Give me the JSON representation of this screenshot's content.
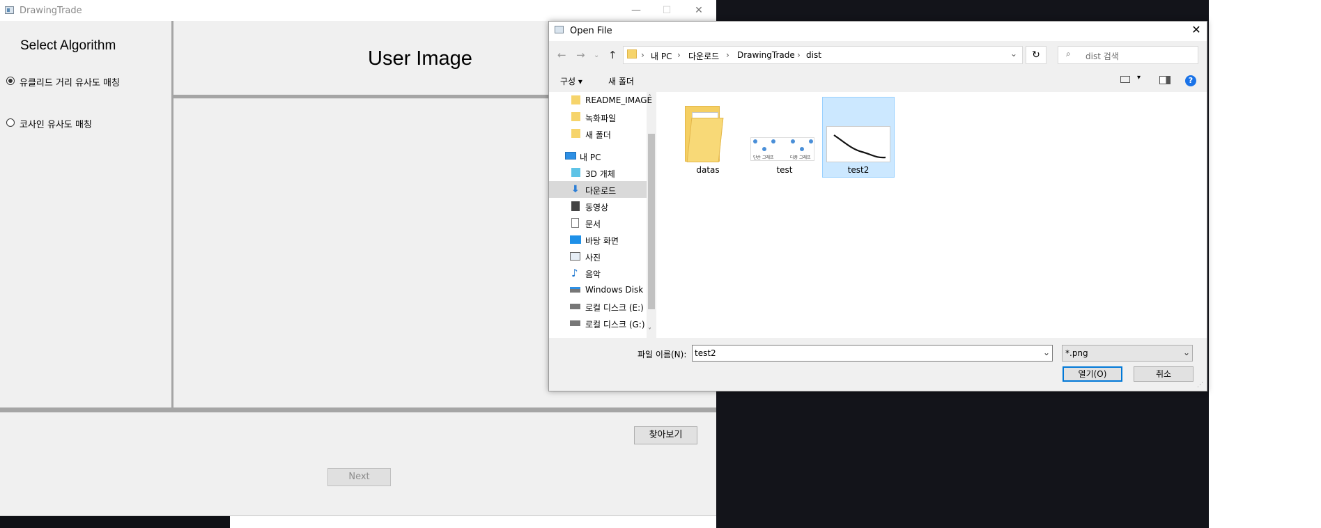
{
  "app": {
    "title": "DrawingTrade",
    "select_title": "Select Algorithm",
    "radio_1": "유클리드 거리 유사도 매칭",
    "radio_2": "코사인 유사도 매칭",
    "user_title": "User Image",
    "browse_button": "찾아보기",
    "next_button": "Next"
  },
  "dialog": {
    "title": "Open File",
    "breadcrumbs": [
      "내 PC",
      "다운로드",
      "DrawingTrade",
      "dist"
    ],
    "search_placeholder": "dist 검색",
    "toolbar": {
      "organize": "구성 ▾",
      "new_folder": "새 폴더"
    },
    "nav_items": [
      {
        "label": "README_IMAGE",
        "icon": "folder-icon"
      },
      {
        "label": "녹화파일",
        "icon": "folder-icon"
      },
      {
        "label": "새 폴더",
        "icon": "folder-icon"
      },
      {
        "label": "내 PC",
        "icon": "computer-icon"
      },
      {
        "label": "3D 개체",
        "icon": "3d-objects-icon"
      },
      {
        "label": "다운로드",
        "icon": "download-icon"
      },
      {
        "label": "동영상",
        "icon": "video-icon"
      },
      {
        "label": "문서",
        "icon": "document-icon"
      },
      {
        "label": "바탕 화면",
        "icon": "desktop-icon"
      },
      {
        "label": "사진",
        "icon": "pictures-icon"
      },
      {
        "label": "음악",
        "icon": "music-icon"
      },
      {
        "label": "Windows Disk (",
        "icon": "drive-icon"
      },
      {
        "label": "로컬 디스크 (E:)",
        "icon": "drive-icon"
      },
      {
        "label": "로컬 디스크 (G:)",
        "icon": "drive-icon"
      }
    ],
    "files": [
      {
        "label": "datas",
        "type": "folder"
      },
      {
        "label": "test",
        "type": "image"
      },
      {
        "label": "test2",
        "type": "image",
        "selected": true
      }
    ],
    "test_thumb_labels": [
      "단순 그래프",
      "다중 그래프"
    ],
    "filename_label": "파일 이름(N):",
    "filename_value": "test2",
    "filter_value": "*.png",
    "open_button": "열기(O)",
    "cancel_button": "취소"
  },
  "colors": {
    "accent": "#0078d7",
    "selection_bg": "#cce8ff",
    "help_blue": "#1a73e8"
  }
}
